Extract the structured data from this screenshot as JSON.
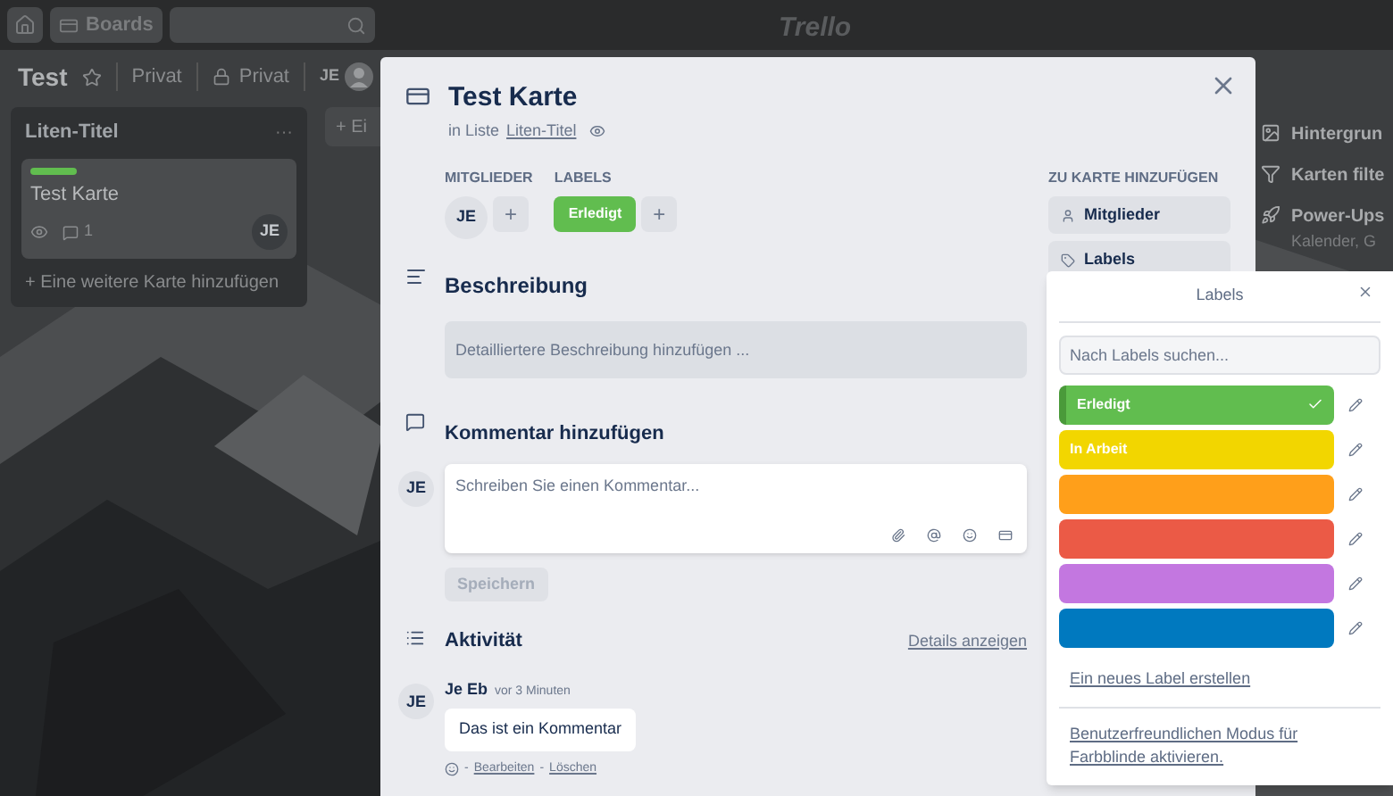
{
  "topbar": {
    "boards": "Boards",
    "logo": "Trello"
  },
  "board": {
    "title": "Test",
    "visibility": "Privat",
    "team": "Privat",
    "members": [
      "JE"
    ]
  },
  "lists": [
    {
      "title": "Liten-Titel",
      "menu": "···",
      "cards": [
        {
          "title": "Test Karte",
          "labels": [
            {
              "color": "#61bd4f"
            }
          ],
          "comments": "1",
          "member": "JE"
        }
      ],
      "add": "+ Eine weitere Karte hinzufügen"
    }
  ],
  "next_list": {
    "add": "+ Ei"
  },
  "board_menu": [
    {
      "kind": "background",
      "label": "Hintergrun"
    },
    {
      "kind": "filter",
      "label": "Karten filte"
    },
    {
      "kind": "powerups",
      "label": "Power-Ups",
      "sub": "Kalender, G"
    }
  ],
  "card": {
    "title": "Test Karte",
    "in_list": "in Liste",
    "list_name": "Liten-Titel",
    "members_heading": "MITGLIEDER",
    "members": [
      "JE"
    ],
    "add_member": "+",
    "labels_heading": "LABELS",
    "labels": [
      {
        "name": "Erledigt",
        "color": "#61bd4f"
      }
    ],
    "add_label": "+",
    "description_heading": "Beschreibung",
    "description": {
      "placeholder": "Detailliertere Beschreibung hinzufügen ..."
    },
    "comment_heading": "Kommentar hinzufügen",
    "comment_author": "JE",
    "comment": {
      "placeholder": "Schreiben Sie einen Kommentar..."
    },
    "save": "Speichern",
    "activity_heading": "Aktivität",
    "details": "Details anzeigen",
    "activity": [
      {
        "avatar": "JE",
        "author": "Je Eb",
        "time": "vor 3 Minuten",
        "text": "Das ist ein Kommentar",
        "edit": "Bearbeiten",
        "delete": "Löschen",
        "sep": "-"
      }
    ],
    "sidebar_heading": "ZU KARTE HINZUFÜGEN",
    "sidebar": [
      {
        "kind": "members",
        "label": "Mitglieder"
      },
      {
        "kind": "labels",
        "label": "Labels"
      }
    ]
  },
  "popup": {
    "title": "Labels",
    "search": {
      "placeholder": "Nach Labels suchen..."
    },
    "labels": [
      {
        "name": "Erledigt",
        "color": "#61bd4f",
        "selected": true
      },
      {
        "name": "In Arbeit",
        "color": "#f2d600",
        "selected": false
      },
      {
        "color": "#ff9f1a",
        "selected": false
      },
      {
        "color": "#eb5a46",
        "selected": false
      },
      {
        "color": "#c377e0",
        "selected": false
      },
      {
        "color": "#0079bf",
        "selected": false
      }
    ],
    "create": "Ein neues Label erstellen",
    "colorblind": "Benutzerfreundlichen Modus für Farbblinde aktivieren."
  }
}
